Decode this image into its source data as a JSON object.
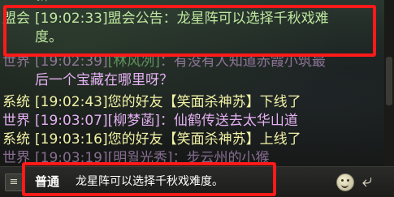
{
  "chat": {
    "messages": [
      {
        "channel": "盟会",
        "time": "[19:02:33]",
        "text": "盟会公告：龙星阵可以选择千秋戏难",
        "text2": "度。"
      },
      {
        "channel": "世界",
        "time": "[19:02:39]",
        "name": "[林风冽]",
        "text": "：有没有人知道赤霞小筑最",
        "text2": "后一个宝藏在哪里呀？"
      },
      {
        "channel": "系统",
        "time": "[19:02:43]",
        "text": "您的好友【笑面杀神苏】下线了"
      },
      {
        "channel": "世界",
        "time": "[19:03:07]",
        "name": "[柳梦菡]",
        "text": "：仙鹤传送去太华山道"
      },
      {
        "channel": "系统",
        "time": "[19:03:16]",
        "text": "您的好友【笑面杀神苏】上线了"
      },
      {
        "channel": "世界",
        "time": "[19:03:19]",
        "name": "[明월光秀]",
        "text": "：步云州的小猴"
      }
    ],
    "top_partial": "新"
  },
  "input_bar": {
    "channel": "普通",
    "value": "龙星阵可以选择千秋戏难度。",
    "menu_glyph": "≡"
  },
  "icons": {
    "emoji": "smiley-icon",
    "send": "send-arrow-icon"
  },
  "colors": {
    "highlight": "#ff1a1a",
    "alliance": "#bfe8a0",
    "world": "#e4b0f2",
    "system": "#f2f2a6"
  }
}
